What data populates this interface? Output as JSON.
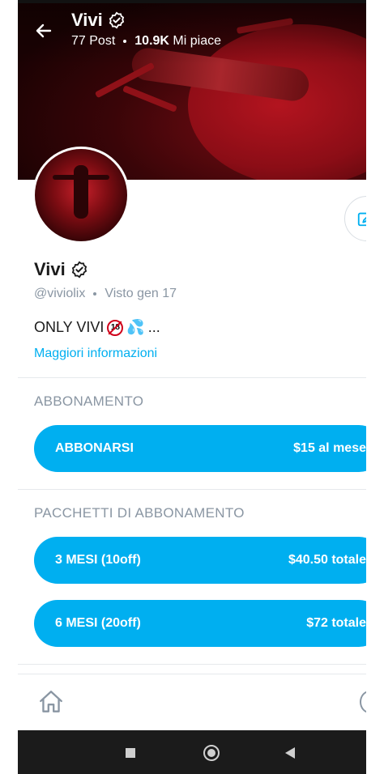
{
  "header": {
    "name": "Vivi",
    "posts": "77 Post",
    "likes_count": "10.9K",
    "likes_label": "Mi piace"
  },
  "profile": {
    "name": "Vivi",
    "handle": "@viviolix",
    "last_seen": "Visto gen 17",
    "bio": "ONLY VIVI",
    "bio_ellipsis": "...",
    "more_link": "Maggiori informazioni"
  },
  "subscription": {
    "section_title": "ABBONAMENTO",
    "button_label": "ABBONARSI",
    "button_price": "$15 al mese"
  },
  "bundles": {
    "section_title": "PACCHETTI DI ABBONAMENTO",
    "items": [
      {
        "label": "3 MESI (10off)",
        "price": "$40.50 totale"
      },
      {
        "label": "6 MESI (20off)",
        "price": "$72 totale"
      }
    ]
  },
  "colors": {
    "accent": "#00aff0",
    "muted": "#8a96a3",
    "text": "#1b1b1b"
  },
  "icons": {
    "back": "arrow-left-icon",
    "verified": "verified-badge-icon",
    "edit": "edit-icon",
    "home": "home-icon"
  }
}
